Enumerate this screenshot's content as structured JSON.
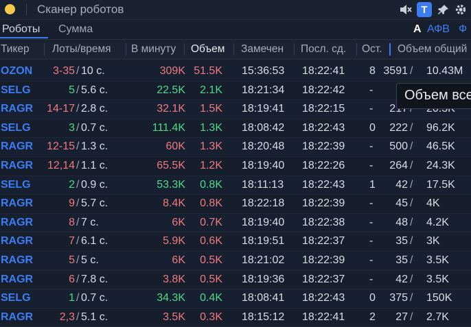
{
  "titlebar": {
    "title": "Сканер роботов",
    "badge": "T"
  },
  "tabs": [
    "Роботы",
    "Сумма"
  ],
  "tab_right": {
    "a": "A",
    "afv": "АФВ",
    "f": "Ф"
  },
  "colors": {
    "accent": "#3c7df3",
    "red": "#f07a80",
    "green": "#4fd98a",
    "yellow_dot": "#f3c94a"
  },
  "columns": [
    "Тикер",
    "Лоты/время",
    "В минуту",
    "Объем",
    "Замечен",
    "Посл. сд.",
    "Ост.",
    "Объем общий"
  ],
  "rows": [
    {
      "ticker": "OZON",
      "lots": "3-35",
      "time": "10 с.",
      "per_min": "309K",
      "volume": "51.5K",
      "seen": "15:36:53",
      "last": "18:22:41",
      "rest": "8",
      "tv1": "3591",
      "tv2": "10.43M",
      "color": "red"
    },
    {
      "ticker": "SELG",
      "lots": "5",
      "time": "5.6 с.",
      "per_min": "22.5K",
      "volume": "2.1K",
      "seen": "18:21:34",
      "last": "18:22:42",
      "rest": "-",
      "tv1": "",
      "tv2": "",
      "color": "green"
    },
    {
      "ticker": "RAGR",
      "lots": "14-17",
      "time": "2.8 с.",
      "per_min": "32.1K",
      "volume": "1.5K",
      "seen": "18:19:41",
      "last": "18:22:15",
      "rest": "-",
      "tv1": "217",
      "tv2": "20.3K",
      "color": "red"
    },
    {
      "ticker": "SELG",
      "lots": "3",
      "time": "0.7 с.",
      "per_min": "111.4K",
      "volume": "1.3K",
      "seen": "18:08:42",
      "last": "18:22:43",
      "rest": "0",
      "tv1": "222",
      "tv2": "96.2K",
      "color": "green"
    },
    {
      "ticker": "RAGR",
      "lots": "12-15",
      "time": "1.3 с.",
      "per_min": "60K",
      "volume": "1.3K",
      "seen": "18:20:48",
      "last": "18:22:39",
      "rest": "-",
      "tv1": "500",
      "tv2": "46.5K",
      "color": "red"
    },
    {
      "ticker": "RAGR",
      "lots": "12,14",
      "time": "1.1 с.",
      "per_min": "65.5K",
      "volume": "1.2K",
      "seen": "18:19:40",
      "last": "18:22:26",
      "rest": "-",
      "tv1": "264",
      "tv2": "24.3K",
      "color": "red"
    },
    {
      "ticker": "SELG",
      "lots": "2",
      "time": "0.9 с.",
      "per_min": "53.3K",
      "volume": "0.8K",
      "seen": "18:11:13",
      "last": "18:22:43",
      "rest": "1",
      "tv1": "42",
      "tv2": "17.5K",
      "color": "green"
    },
    {
      "ticker": "RAGR",
      "lots": "9",
      "time": "5.7 с.",
      "per_min": "8.4K",
      "volume": "0.8K",
      "seen": "18:22:18",
      "last": "18:22:39",
      "rest": "-",
      "tv1": "45",
      "tv2": "4K",
      "color": "red"
    },
    {
      "ticker": "RAGR",
      "lots": "8",
      "time": "7 с.",
      "per_min": "6K",
      "volume": "0.7K",
      "seen": "18:19:40",
      "last": "18:22:38",
      "rest": "-",
      "tv1": "48",
      "tv2": "4.2K",
      "color": "red"
    },
    {
      "ticker": "RAGR",
      "lots": "7",
      "time": "6.1 с.",
      "per_min": "5.9K",
      "volume": "0.6K",
      "seen": "18:19:51",
      "last": "18:22:37",
      "rest": "-",
      "tv1": "35",
      "tv2": "3K",
      "color": "red"
    },
    {
      "ticker": "RAGR",
      "lots": "5",
      "time": "5 с.",
      "per_min": "6K",
      "volume": "0.5K",
      "seen": "18:21:02",
      "last": "18:22:39",
      "rest": "-",
      "tv1": "35",
      "tv2": "3.5K",
      "color": "red"
    },
    {
      "ticker": "RAGR",
      "lots": "6",
      "time": "7.8 с.",
      "per_min": "3.8K",
      "volume": "0.5K",
      "seen": "18:19:36",
      "last": "18:22:37",
      "rest": "-",
      "tv1": "42",
      "tv2": "3.5K",
      "color": "red"
    },
    {
      "ticker": "SELG",
      "lots": "1",
      "time": "0.7 с.",
      "per_min": "34.3K",
      "volume": "0.4K",
      "seen": "18:08:41",
      "last": "18:22:43",
      "rest": "0",
      "tv1": "375",
      "tv2": "150K",
      "color": "green"
    },
    {
      "ticker": "RAGR",
      "lots": "2,3",
      "time": "5.1 с.",
      "per_min": "3.5K",
      "volume": "0.3K",
      "seen": "18:15:12",
      "last": "18:22:41",
      "rest": "2",
      "tv1": "27",
      "tv2": "2.7K",
      "color": "red"
    }
  ],
  "tooltip": "Объем все"
}
